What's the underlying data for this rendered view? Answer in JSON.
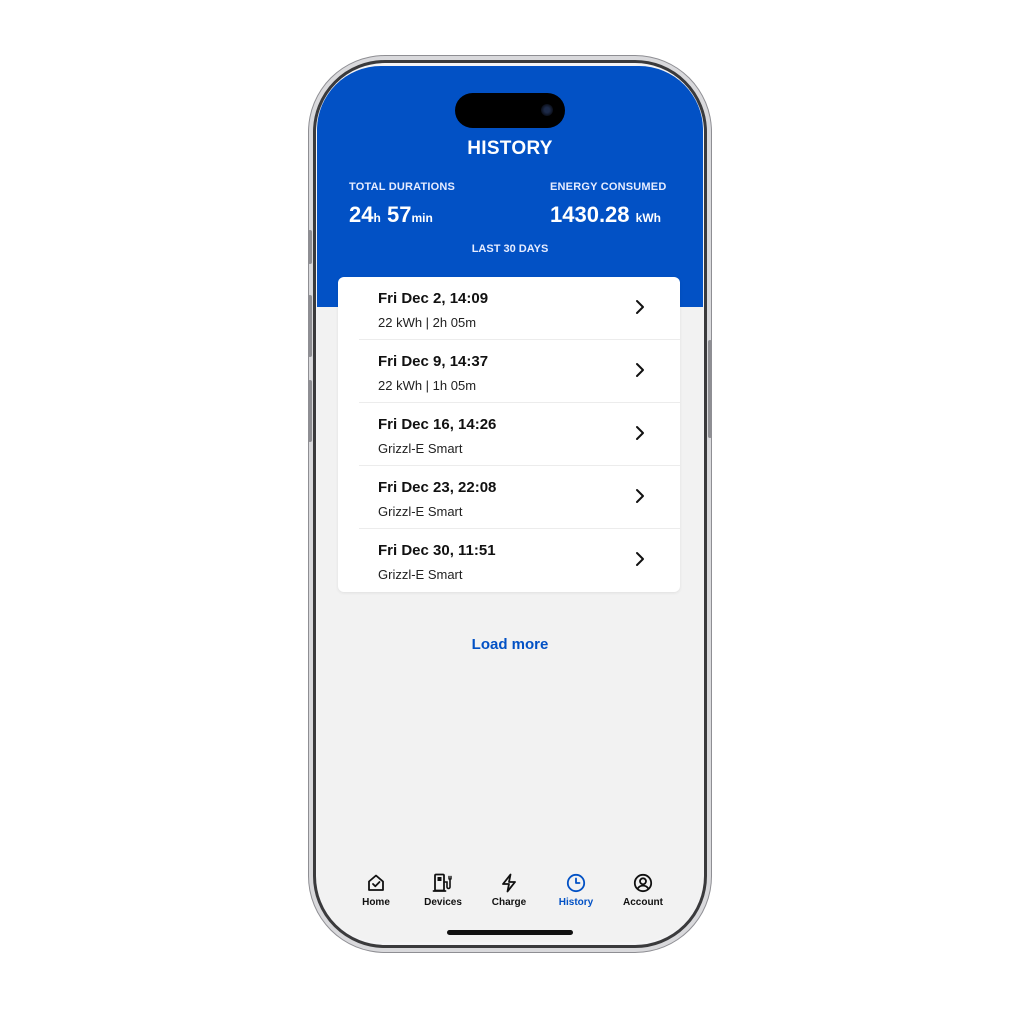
{
  "colors": {
    "accent": "#0251c5",
    "background": "#f2f2f2",
    "card": "#ffffff"
  },
  "header": {
    "title": "HISTORY",
    "total_durations": {
      "label": "TOTAL DURATIONS",
      "hours": "24",
      "hours_unit": "h",
      "minutes": "57",
      "minutes_unit": "min"
    },
    "energy_consumed": {
      "label": "ENERGY CONSUMED",
      "value": "1430.28",
      "unit": "kWh"
    },
    "period": "LAST 30 DAYS"
  },
  "sessions": [
    {
      "title": "Fri Dec 2, 14:09",
      "subtitle": "22 kWh | 2h 05m",
      "icon": "chevron-right-icon"
    },
    {
      "title": "Fri Dec 9, 14:37",
      "subtitle": "22 kWh | 1h 05m",
      "icon": "chevron-right-icon"
    },
    {
      "title": "Fri Dec 16, 14:26",
      "subtitle": "Grizzl-E Smart",
      "icon": "chevron-right-icon"
    },
    {
      "title": "Fri Dec 23, 22:08",
      "subtitle": "Grizzl-E Smart",
      "icon": "chevron-right-icon"
    },
    {
      "title": "Fri Dec 30, 11:51",
      "subtitle": "Grizzl-E Smart",
      "icon": "chevron-right-icon"
    }
  ],
  "load_more": "Load more",
  "tabs": [
    {
      "label": "Home",
      "icon": "home-icon",
      "active": false
    },
    {
      "label": "Devices",
      "icon": "charging-station-icon",
      "active": false
    },
    {
      "label": "Charge",
      "icon": "lightning-icon",
      "active": false
    },
    {
      "label": "History",
      "icon": "clock-icon",
      "active": true
    },
    {
      "label": "Account",
      "icon": "user-circle-icon",
      "active": false
    }
  ]
}
